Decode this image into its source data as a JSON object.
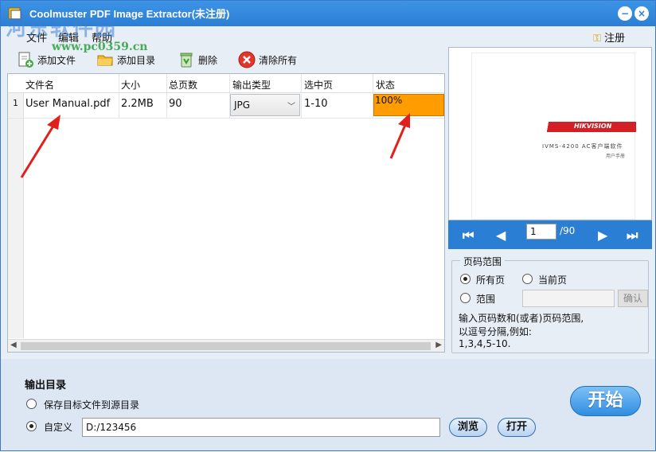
{
  "window": {
    "title": "Coolmuster PDF Image Extractor(未注册)",
    "minimize_glyph": "−",
    "close_glyph": "×"
  },
  "menu": {
    "file": "文件",
    "edit": "编辑",
    "help": "帮助",
    "register": "注册"
  },
  "watermark": {
    "text": "河东软件园",
    "url": "www.pc0359.cn"
  },
  "toolbar": {
    "add_file": "添加文件",
    "add_dir": "添加目录",
    "delete": "删除",
    "clear_all": "清除所有"
  },
  "table": {
    "headers": [
      "文件名",
      "大小",
      "总页数",
      "输出类型",
      "选中页",
      "状态"
    ],
    "rows": [
      {
        "index": "1",
        "filename": "User Manual.pdf",
        "size": "2.2MB",
        "pages": "90",
        "output_type": "JPG",
        "selected_pages": "1-10",
        "status": "100%"
      }
    ]
  },
  "preview": {
    "brand": "HIKVISION",
    "doc_line1": "IVMS-4200 AC客户端软件",
    "doc_line2": "用户手册",
    "current_page": "1",
    "total_pages": "/90"
  },
  "page_range": {
    "title": "页码范围",
    "all_pages": "所有页",
    "current_page": "当前页",
    "range": "范围",
    "confirm": "确认",
    "hint1": "输入页码数和(或者)页码范围,",
    "hint2": "以逗号分隔,例如:",
    "hint3": "1,3,4,5-10.",
    "selected": "all_pages"
  },
  "output": {
    "title": "输出目录",
    "save_to_source": "保存目标文件到源目录",
    "custom": "自定义",
    "path": "D:/123456",
    "browse": "浏览",
    "open": "打开",
    "start": "开始",
    "selected": "custom"
  },
  "colors": {
    "title_bar": "#2a7fd4",
    "status_fill": "#ff9d00",
    "arrow": "#e0211b",
    "brand_red": "#d51f26"
  }
}
